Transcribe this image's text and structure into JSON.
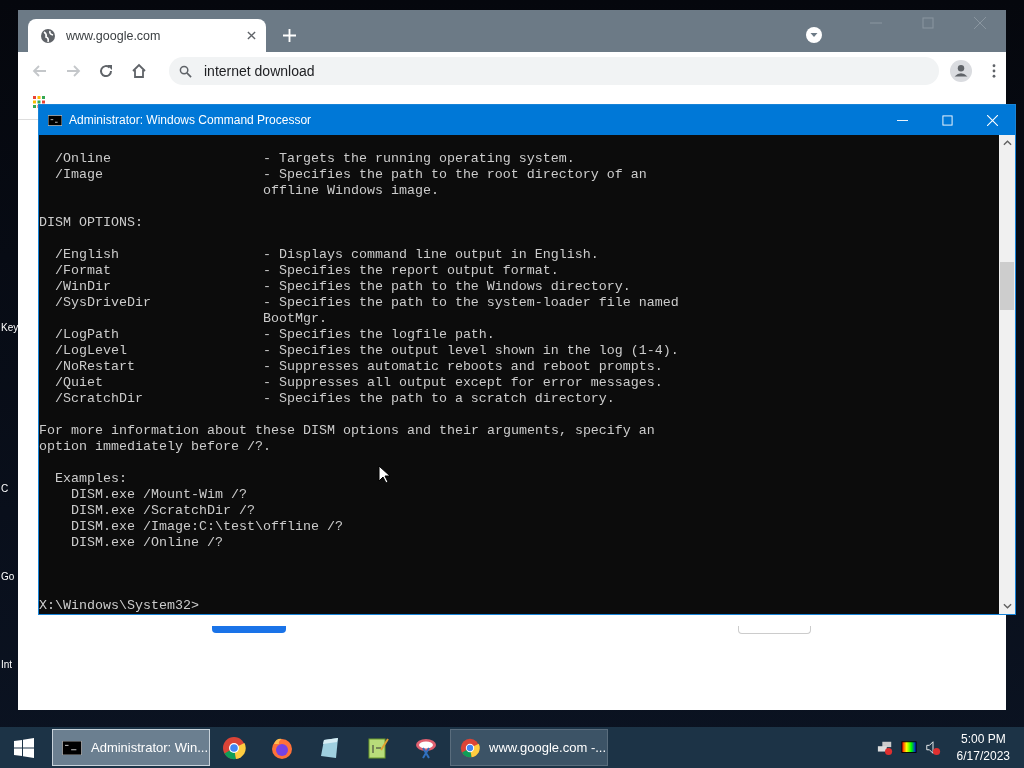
{
  "desktop_icons": [
    {
      "label": "Key"
    },
    {
      "label": "C"
    },
    {
      "label": "Go"
    },
    {
      "label": "Int"
    }
  ],
  "browser": {
    "tabs": [
      {
        "title": "www.google.com",
        "selected": true
      }
    ],
    "address": "internet download"
  },
  "console": {
    "title": "Administrator: Windows Command Processor",
    "blocks": [
      {
        "kind": "options",
        "items": [
          {
            "name": "/Online",
            "desc": [
              "- Targets the running operating system."
            ]
          },
          {
            "name": "/Image",
            "desc": [
              "- Specifies the path to the root directory of an",
              "offline Windows image."
            ]
          }
        ]
      },
      {
        "kind": "text",
        "lines": [
          "DISM OPTIONS:"
        ]
      },
      {
        "kind": "options",
        "items": [
          {
            "name": "/English",
            "desc": [
              "- Displays command line output in English."
            ]
          },
          {
            "name": "/Format",
            "desc": [
              "- Specifies the report output format."
            ]
          },
          {
            "name": "/WinDir",
            "desc": [
              "- Specifies the path to the Windows directory."
            ]
          },
          {
            "name": "/SysDriveDir",
            "desc": [
              "- Specifies the path to the system-loader file named",
              "BootMgr."
            ]
          },
          {
            "name": "/LogPath",
            "desc": [
              "- Specifies the logfile path."
            ]
          },
          {
            "name": "/LogLevel",
            "desc": [
              "- Specifies the output level shown in the log (1-4)."
            ]
          },
          {
            "name": "/NoRestart",
            "desc": [
              "- Suppresses automatic reboots and reboot prompts."
            ]
          },
          {
            "name": "/Quiet",
            "desc": [
              "- Suppresses all output except for error messages."
            ]
          },
          {
            "name": "/ScratchDir",
            "desc": [
              "- Specifies the path to a scratch directory."
            ]
          }
        ]
      },
      {
        "kind": "text",
        "lines": [
          "For more information about these DISM options and their arguments, specify an",
          "option immediately before /?."
        ]
      },
      {
        "kind": "examples",
        "heading": "Examples:",
        "lines": [
          "DISM.exe /Mount-Wim /?",
          "DISM.exe /ScratchDir /?",
          "DISM.exe /Image:C:\\test\\offline /?",
          "DISM.exe /Online /?"
        ]
      }
    ],
    "prompt": "X:\\Windows\\System32>"
  },
  "taskbar": {
    "windows": [
      {
        "label": "Administrator: Win...",
        "selected": true
      },
      {
        "label": "www.google.com -...",
        "selected": false
      }
    ],
    "clock": {
      "time": "5:00 PM",
      "date": "6/17/2023"
    }
  }
}
